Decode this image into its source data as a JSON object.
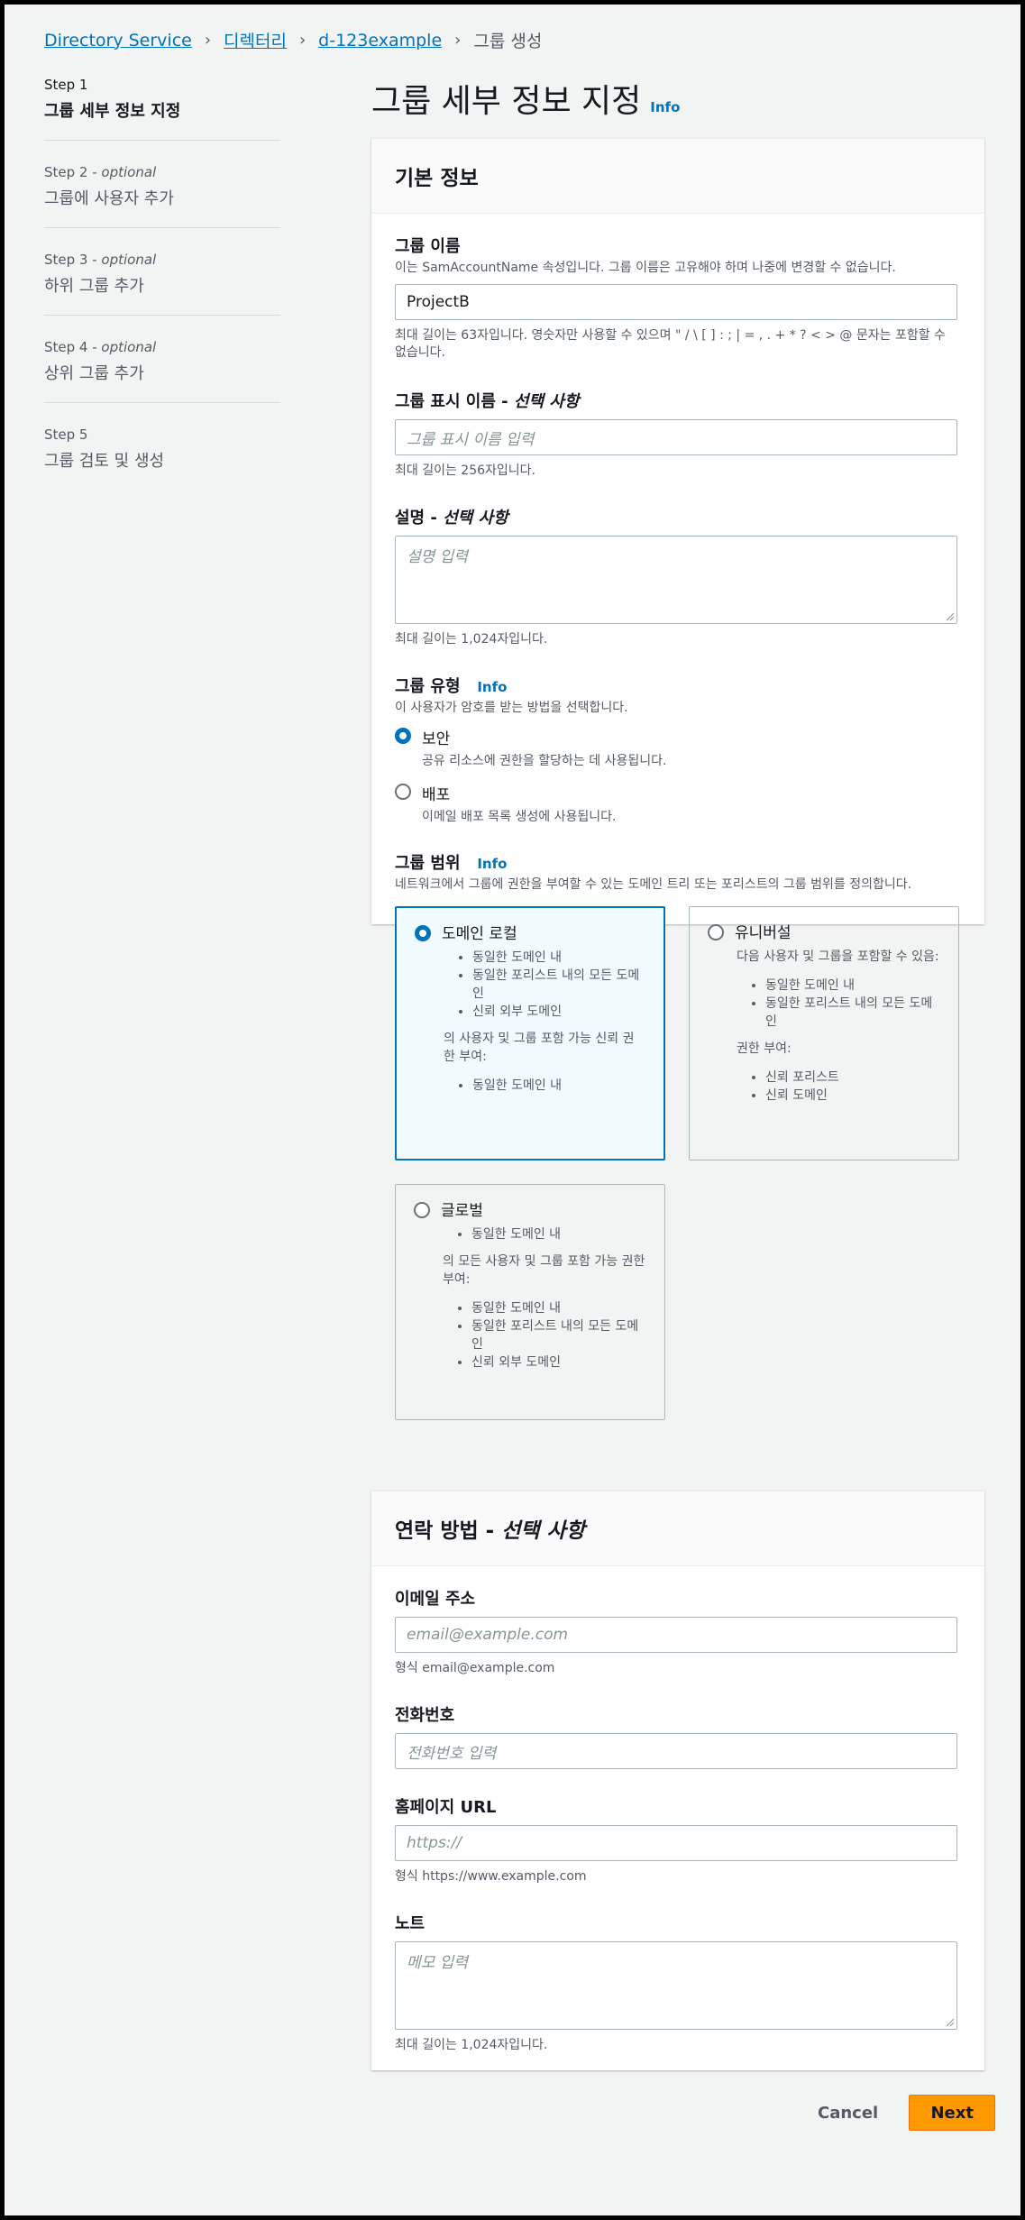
{
  "breadcrumb": {
    "items": [
      "Directory Service",
      "디렉터리",
      "d-123example"
    ],
    "current": "그룹 생성"
  },
  "steps": [
    {
      "num": "Step 1",
      "optional": "",
      "name": "그룹 세부 정보 지정",
      "active": true
    },
    {
      "num": "Step 2",
      "optional": "optional",
      "name": "그룹에 사용자 추가"
    },
    {
      "num": "Step 3",
      "optional": "optional",
      "name": "하위 그룹 추가"
    },
    {
      "num": "Step 4",
      "optional": "optional",
      "name": "상위 그룹 추가"
    },
    {
      "num": "Step 5",
      "optional": "",
      "name": "그룹 검토 및 생성"
    }
  ],
  "page_title": "그룹 세부 정보 지정",
  "info_link": "Info",
  "basic": {
    "header": "기본 정보",
    "group_name": {
      "label": "그룹 이름",
      "desc": "이는 SamAccountName 속성입니다. 그룹 이름은 고유해야 하며 나중에 변경할 수 없습니다.",
      "value": "ProjectB",
      "hint": "최대 길이는 63자입니다. 영숫자만 사용할 수 있으며 \" / \\ [ ] : ; | = , . + * ? < > @ 문자는 포함할 수 없습니다."
    },
    "display_name": {
      "label": "그룹 표시 이름 - ",
      "label_optional": "선택 사항",
      "placeholder": "그룹 표시 이름 입력",
      "hint": "최대 길이는 256자입니다."
    },
    "description": {
      "label": "설명 - ",
      "label_optional": "선택 사항",
      "placeholder": "설명 입력",
      "hint": "최대 길이는 1,024자입니다."
    },
    "group_type": {
      "label": "그룹 유형",
      "info": "Info",
      "desc": "이 사용자가 암호를 받는 방법을 선택합니다.",
      "options": [
        {
          "title": "보안",
          "desc": "공유 리소스에 권한을 할당하는 데 사용됩니다.",
          "selected": true
        },
        {
          "title": "배포",
          "desc": "이메일 배포 목록 생성에 사용됩니다.",
          "selected": false
        }
      ]
    },
    "group_scope": {
      "label": "그룹 범위",
      "info": "Info",
      "desc": "네트워크에서 그룹에 권한을 부여할 수 있는 도메인 트리 또는 포리스트의 그룹 범위를 정의합니다.",
      "tiles": {
        "domain_local": {
          "title": "도메인 로컬",
          "list1": [
            "동일한 도메인 내",
            "동일한 포리스트 내의 모든 도메인",
            "신뢰 외부 도메인"
          ],
          "text": "의 사용자 및 그룹 포함 가능 신뢰 권한 부여:",
          "list2": [
            "동일한 도메인 내"
          ]
        },
        "universal": {
          "title": "유니버설",
          "intro": "다음 사용자 및 그룹을 포함할 수 있음:",
          "list1": [
            "동일한 도메인 내",
            "동일한 포리스트 내의 모든 도메인"
          ],
          "text": "권한 부여:",
          "list2": [
            "신뢰 포리스트",
            "신뢰 도메인"
          ]
        },
        "global": {
          "title": "글로벌",
          "list1": [
            "동일한 도메인 내"
          ],
          "text": "의 모든 사용자 및 그룹 포함 가능 권한 부여:",
          "list2": [
            "동일한 도메인 내",
            "동일한 포리스트 내의 모든 도메인",
            "신뢰 외부 도메인"
          ]
        }
      }
    }
  },
  "contact": {
    "header": "연락 방법 - ",
    "header_optional": "선택 사항",
    "email": {
      "label": "이메일 주소",
      "placeholder": "email@example.com",
      "hint": "형식 email@example.com"
    },
    "phone": {
      "label": "전화번호",
      "placeholder": "전화번호 입력"
    },
    "homepage": {
      "label": "홈페이지 URL",
      "placeholder": "https://",
      "hint": "형식 https://www.example.com"
    },
    "notes": {
      "label": "노트",
      "placeholder": "메모 입력",
      "hint": "최대 길이는 1,024자입니다."
    }
  },
  "buttons": {
    "cancel": "Cancel",
    "next": "Next"
  }
}
